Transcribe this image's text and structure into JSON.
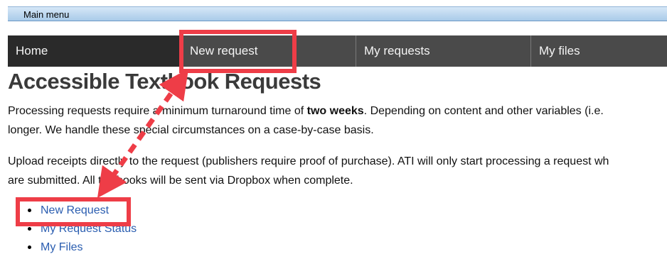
{
  "menubar": {
    "label": "Main menu"
  },
  "nav": {
    "items": [
      {
        "label": "Home"
      },
      {
        "label": "New request"
      },
      {
        "label": "My requests"
      },
      {
        "label": "My files"
      }
    ]
  },
  "main": {
    "title": "Accessible Textbook Requests",
    "paragraph1": {
      "line1_before": "Processing requests require a minimum turnaround time of ",
      "line1_bold": "two weeks",
      "line1_after": ". Depending on content and other variables (i.e.",
      "line2": "longer. We handle these special circumstances on a case-by-case basis."
    },
    "paragraph2": {
      "line1": "Upload receipts directly to the request (publishers require proof of purchase). ATI will only start processing a request wh",
      "line2": "are submitted. All textbooks will be sent via Dropbox when complete."
    },
    "links": [
      {
        "label": "New Request"
      },
      {
        "label": "My Request Status"
      },
      {
        "label": "My Files"
      }
    ]
  },
  "annotation": {
    "color": "#ee3d47"
  }
}
